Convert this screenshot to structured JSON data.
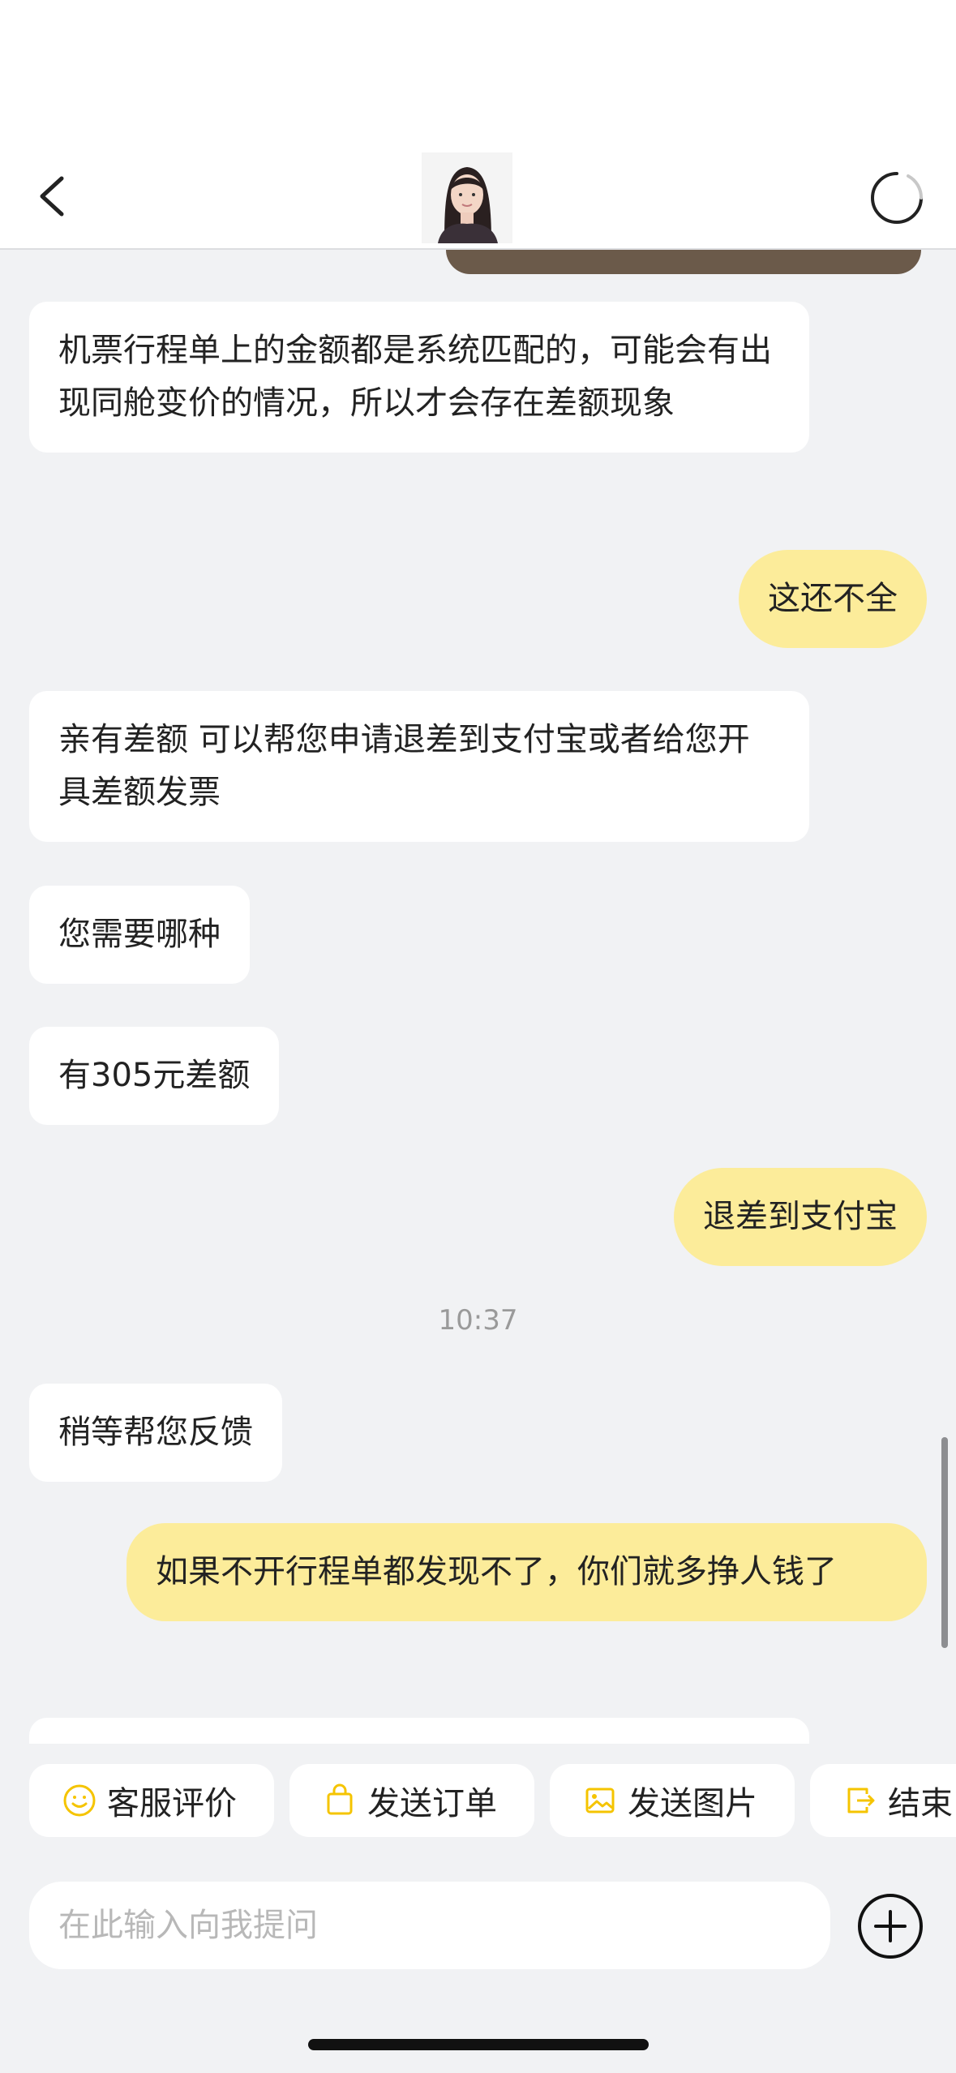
{
  "header": {
    "back_icon": "chevron-left-icon",
    "avatar": "agent-avatar",
    "refresh_icon": "refresh-spinner-icon"
  },
  "messages": [
    {
      "from": "agent",
      "text": "机票行程单上的金额都是系统匹配的，可能会有出现同舱变价的情况，所以才会存在差额现象"
    },
    {
      "from": "user",
      "text": "这还不全"
    },
    {
      "from": "agent",
      "text": "亲有差额 可以帮您申请退差到支付宝或者给您开具差额发票"
    },
    {
      "from": "agent",
      "text": "您需要哪种"
    },
    {
      "from": "agent",
      "text": "有305元差额"
    },
    {
      "from": "user",
      "text": "退差到支付宝"
    },
    {
      "from": "agent",
      "text": "稍等帮您反馈"
    },
    {
      "from": "user",
      "text": "如果不开行程单都发现不了，你们就多挣人钱了"
    }
  ],
  "time_label": "10:37",
  "quick_actions": [
    {
      "label": "客服评价",
      "icon": "smiley-icon"
    },
    {
      "label": "发送订单",
      "icon": "bag-icon"
    },
    {
      "label": "发送图片",
      "icon": "image-icon"
    },
    {
      "label": "结束",
      "icon": "exit-icon"
    }
  ],
  "input": {
    "placeholder": "在此输入向我提问"
  },
  "colors": {
    "accent": "#fcec9a",
    "icon_accent": "#f5c400",
    "background": "#f1f2f4"
  }
}
